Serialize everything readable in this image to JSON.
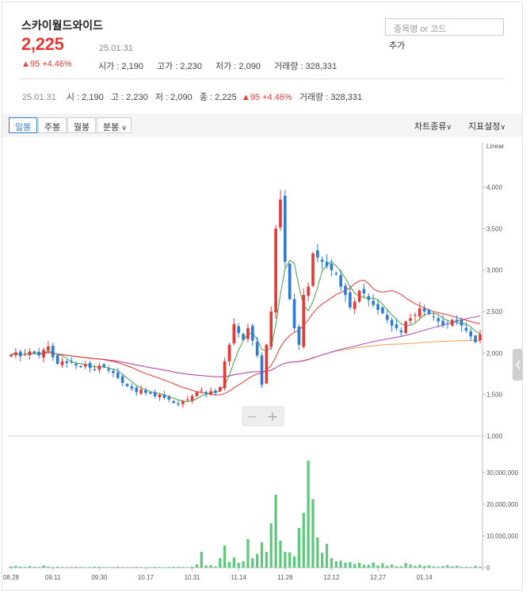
{
  "stock": {
    "name": "스카이월드와이드",
    "price": "2,225",
    "date": "25.01.31",
    "change": "▲95 +4.46%",
    "open_label": "시가 : 2,190",
    "high_label": "고가 : 2,230",
    "low_label": "저가 : 2,090",
    "volume_label": "거래량 : 328,331"
  },
  "search": {
    "placeholder": "종목명 or 코드",
    "add_label": "추가"
  },
  "info_bar": {
    "date": "25.01.31",
    "open": "시 : 2,190",
    "high": "고 : 2,230",
    "low": "저 : 2,090",
    "close": "종 : 2,225",
    "change": "▲95 +4.46%",
    "volume": "거래량 : 328,331"
  },
  "toolbar": {
    "tabs": [
      "일봉",
      "주봉",
      "월봉",
      "분봉"
    ],
    "active_tab": "일봉",
    "chart_type_label": "차트종류",
    "indicator_label": "지표설정"
  },
  "chart_data": {
    "type": "candlestick",
    "scale_label": "Linear",
    "price_ticks": [
      "4,000",
      "3,500",
      "3,000",
      "2,500",
      "2,000",
      "1,500",
      "1,000"
    ],
    "price_tick_values": [
      4000,
      3500,
      3000,
      2500,
      2000,
      1500,
      1000
    ],
    "volume_ticks": [
      "30,000,000",
      "20,000,000",
      "10,000,000",
      "0"
    ],
    "volume_tick_values": [
      30000000,
      20000000,
      10000000,
      0
    ],
    "x_labels": [
      "08.28",
      "09.11",
      "09.30",
      "10.17",
      "10.31",
      "11.14",
      "11.28",
      "12.12",
      "12.27",
      "01.14"
    ],
    "x_label_index": [
      0,
      9,
      19,
      29,
      39,
      49,
      59,
      69,
      79,
      89
    ],
    "zoom_controls": [
      "−",
      "+"
    ],
    "colors": {
      "up": "#e53935",
      "down": "#2e7bcf",
      "ma5": "#43a047",
      "ma20": "#e53935",
      "ma60": "#ab47bc",
      "ma120": "#f0a04b",
      "volume": "#5cc97a"
    },
    "closes": [
      1980,
      2010,
      1960,
      1990,
      2020,
      2000,
      1970,
      2040,
      2080,
      1950,
      1870,
      1900,
      1880,
      1890,
      1850,
      1830,
      1860,
      1820,
      1800,
      1850,
      1830,
      1790,
      1760,
      1700,
      1640,
      1600,
      1570,
      1530,
      1560,
      1520,
      1510,
      1480,
      1500,
      1460,
      1440,
      1400,
      1380,
      1420,
      1440,
      1480,
      1530,
      1550,
      1510,
      1540,
      1520,
      1590,
      1900,
      2100,
      2350,
      2240,
      2160,
      2300,
      2150,
      1970,
      1620,
      2100,
      2500,
      3500,
      3850,
      3100,
      2650,
      2300,
      2100,
      2700,
      2800,
      3200,
      3150,
      3100,
      3050,
      3000,
      2950,
      2800,
      2700,
      2550,
      2620,
      2750,
      2720,
      2640,
      2580,
      2520,
      2480,
      2400,
      2330,
      2300,
      2250,
      2380,
      2420,
      2460,
      2540,
      2500,
      2470,
      2430,
      2380,
      2330,
      2350,
      2400,
      2380,
      2330,
      2270,
      2200,
      2130,
      2225
    ],
    "volumes": [
      400000,
      600000,
      300000,
      200000,
      500000,
      300000,
      200000,
      700000,
      400000,
      200000,
      300000,
      200000,
      150000,
      200000,
      300000,
      200000,
      150000,
      200000,
      300000,
      250000,
      200000,
      150000,
      200000,
      300000,
      200000,
      150000,
      200000,
      250000,
      200000,
      150000,
      200000,
      250000,
      200000,
      150000,
      200000,
      300000,
      250000,
      200000,
      150000,
      300000,
      1000000,
      5000000,
      700000,
      800000,
      400000,
      3000000,
      7000000,
      1800000,
      3200000,
      1500000,
      2000000,
      9000000,
      3000000,
      4300000,
      8000000,
      5000000,
      14000000,
      23000000,
      8500000,
      5000000,
      4800000,
      3500000,
      12500000,
      17300000,
      33700000,
      21600000,
      9500000,
      4700000,
      7500000,
      3000000,
      2000000,
      2200000,
      1600000,
      1800000,
      1200000,
      1500000,
      900000,
      900000,
      1600000,
      700000,
      1400000,
      600000,
      1000000,
      500000,
      400000,
      1500000,
      1000000,
      600000,
      900000,
      500000,
      700000,
      400000,
      300000,
      500000,
      800000,
      400000,
      600000,
      300000,
      250000,
      200000,
      600000,
      330000
    ]
  }
}
